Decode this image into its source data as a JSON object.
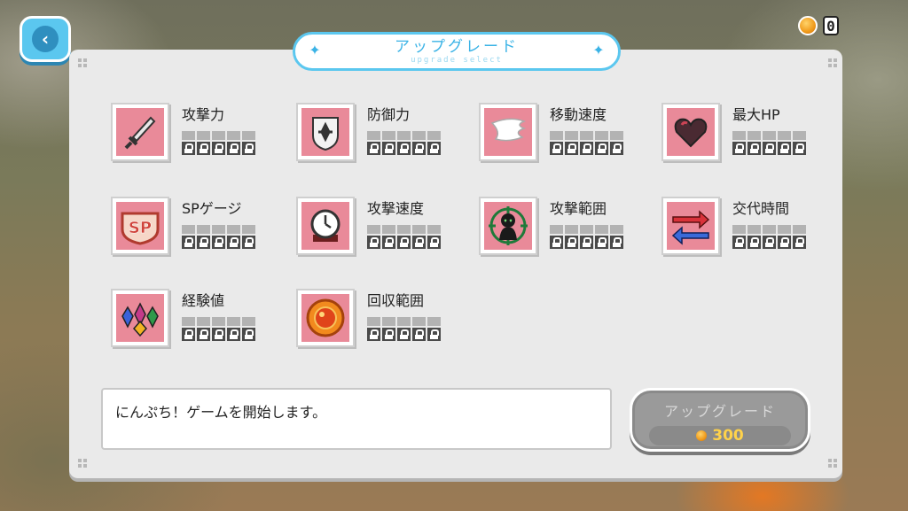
{
  "header": {
    "back_icon": "chevron-left-icon",
    "coin_count": "0",
    "title": "アップグレード",
    "subtitle": "upgrade select"
  },
  "upgrades": [
    {
      "label": "攻撃力",
      "icon": "sword-icon",
      "level": 0,
      "max_level": 5
    },
    {
      "label": "防御力",
      "icon": "shield-icon",
      "level": 0,
      "max_level": 5
    },
    {
      "label": "移動速度",
      "icon": "wing-icon",
      "level": 0,
      "max_level": 5
    },
    {
      "label": "最大HP",
      "icon": "heart-icon",
      "level": 0,
      "max_level": 5
    },
    {
      "label": "SPゲージ",
      "icon": "sp-badge-icon",
      "level": 0,
      "max_level": 5
    },
    {
      "label": "攻撃速度",
      "icon": "clock-icon",
      "level": 0,
      "max_level": 5
    },
    {
      "label": "攻撃範囲",
      "icon": "range-target-icon",
      "level": 0,
      "max_level": 5
    },
    {
      "label": "交代時間",
      "icon": "swap-arrows-icon",
      "level": 0,
      "max_level": 5
    },
    {
      "label": "経験値",
      "icon": "crystals-icon",
      "level": 0,
      "max_level": 5
    },
    {
      "label": "回収範囲",
      "icon": "orb-icon",
      "level": 0,
      "max_level": 5
    }
  ],
  "message": "にんぷち！ゲームを開始します。",
  "upgrade_button": {
    "label": "アップグレード",
    "cost": "300"
  },
  "colors": {
    "accent": "#5bc7ef",
    "icon_bg": "#e98a99",
    "panel": "#eaeaea"
  }
}
